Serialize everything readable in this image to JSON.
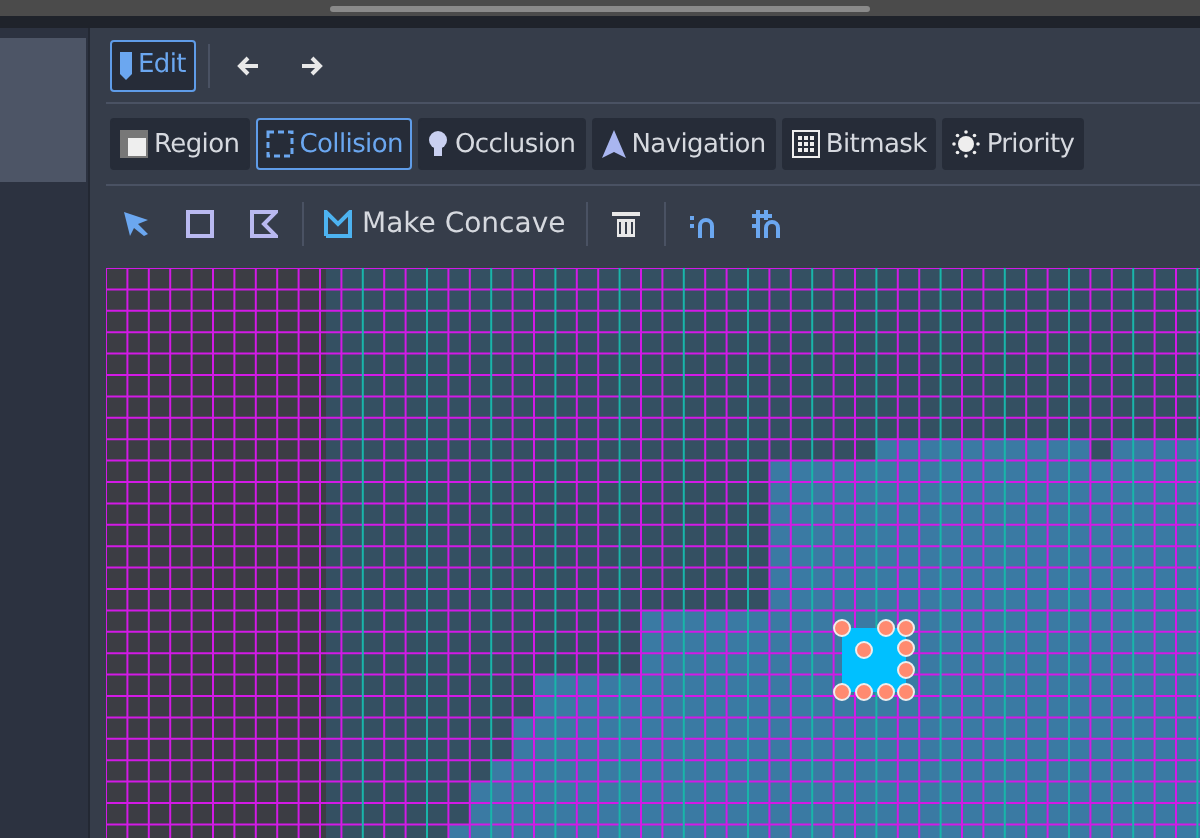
{
  "edit_button": {
    "label": "Edit",
    "selected": true
  },
  "tabs": [
    {
      "label": "Region",
      "kind": "region",
      "selected": false
    },
    {
      "label": "Collision",
      "kind": "collision",
      "selected": true
    },
    {
      "label": "Occlusion",
      "kind": "occlusion",
      "selected": false
    },
    {
      "label": "Navigation",
      "kind": "navigation",
      "selected": false
    },
    {
      "label": "Bitmask",
      "kind": "bitmask",
      "selected": false
    },
    {
      "label": "Priority",
      "kind": "priority",
      "selected": false
    }
  ],
  "tools": [
    {
      "kind": "select",
      "selected": true
    },
    {
      "kind": "rectangle",
      "selected": false
    },
    {
      "kind": "polygon",
      "selected": false
    }
  ],
  "make_concave": {
    "label": "Make Concave"
  }
}
